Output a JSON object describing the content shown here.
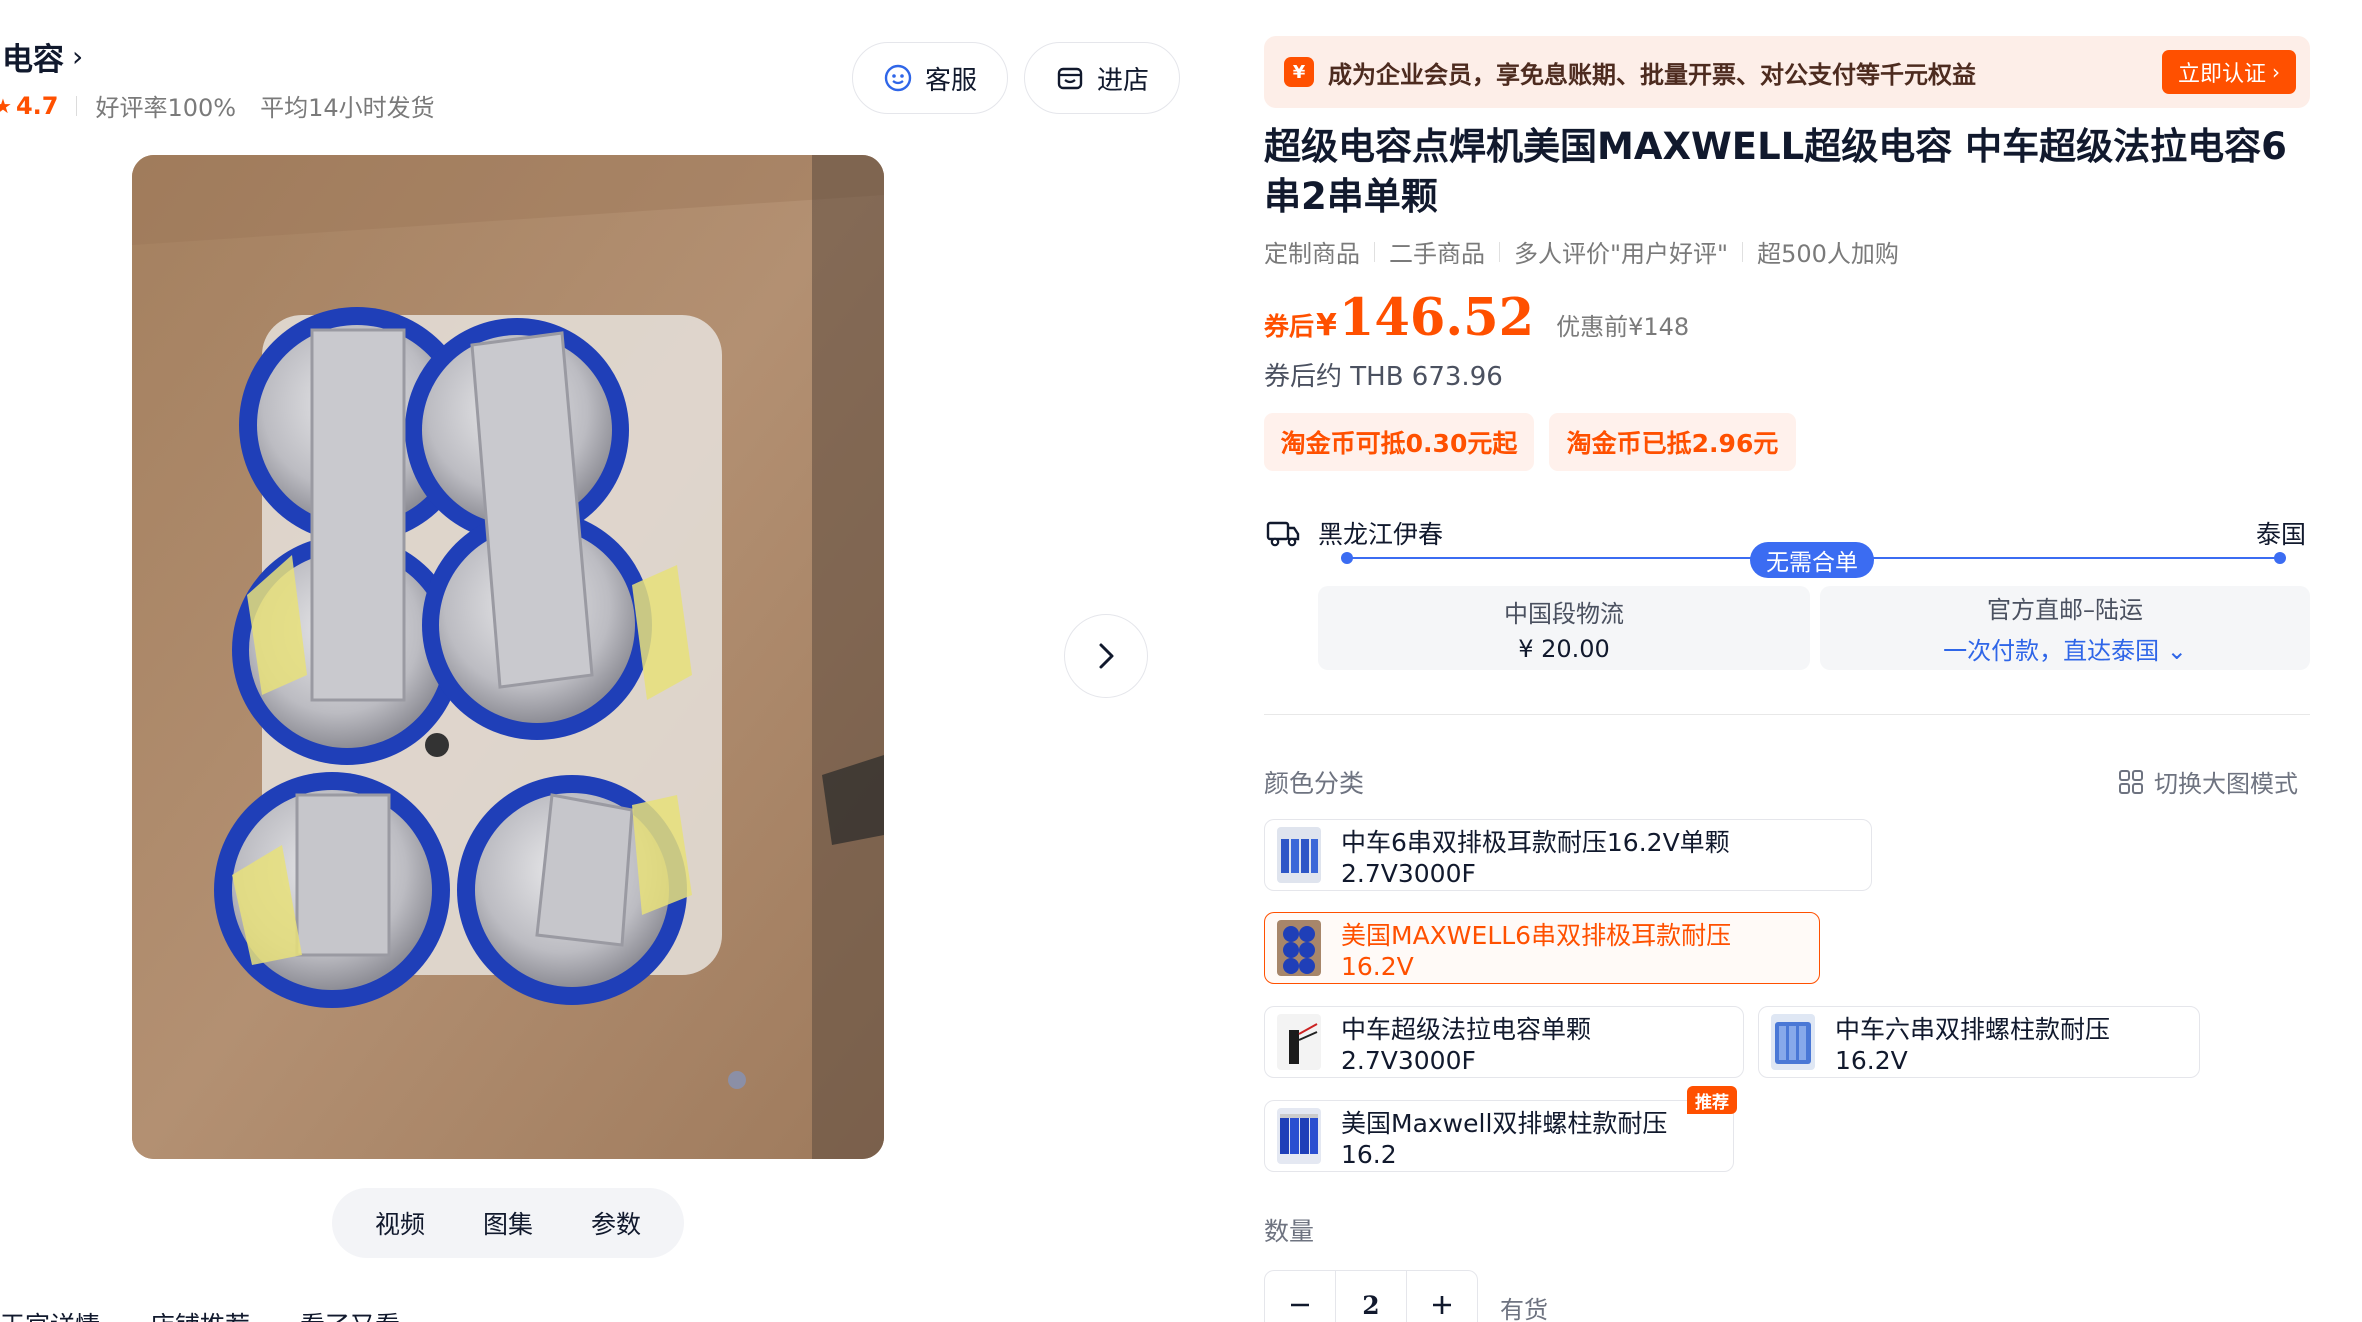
{
  "shop": {
    "name": "电容",
    "rating": "4.7",
    "good_rate": "好评率100%",
    "ship_time": "平均14小时发货"
  },
  "header_buttons": {
    "service": "客服",
    "store": "进店"
  },
  "gallery": {
    "tabs": [
      "视频",
      "图集",
      "参数"
    ]
  },
  "bottom_cut": "天官详情　　店铺推荐　　看了又看",
  "promo": {
    "text": "成为企业会员，享免息账期、批量开票、对公支付等千元权益",
    "button": "立即认证",
    "badge": "¥"
  },
  "product": {
    "title": "超级电容点焊机美国MAXWELL超级电容 中车超级法拉电容6串2串单颗",
    "tags": [
      "定制商品",
      "二手商品",
      "多人评价\"用户好评\"",
      "超500人加购"
    ],
    "price_prefix": "券后",
    "price_symbol": "¥",
    "price": "146.52",
    "original_price": "优惠前¥148",
    "thb": "券后约 THB 673.96",
    "coins": [
      "淘金币可抵0.30元起",
      "淘金币已抵2.96元"
    ]
  },
  "shipping": {
    "origin": "黑龙江伊春",
    "destination": "泰国",
    "badge": "无需合单",
    "segment_label": "中国段物流",
    "segment_price": "¥ 20.00",
    "direct_label": "官方直邮–陆运",
    "direct_note": "一次付款，直达泰国"
  },
  "options": {
    "label": "颜色分类",
    "switch_mode": "切换大图模式",
    "items": [
      {
        "label": "中车6串双排极耳款耐压16.2V单颗2.7V3000F",
        "selected": false
      },
      {
        "label": "美国MAXWELL6串双排极耳款耐压16.2V",
        "selected": true
      },
      {
        "label": "中车超级法拉电容单颗2.7V3000F",
        "selected": false
      },
      {
        "label": "中车六串双排螺柱款耐压16.2V",
        "selected": false
      },
      {
        "label": "美国Maxwell双排螺柱款耐压16.2",
        "selected": false
      }
    ],
    "recommend_badge": "推荐"
  },
  "quantity": {
    "label": "数量",
    "value": "2",
    "stock": "有货"
  },
  "colors": {
    "accent": "#ff5000",
    "blue": "#3b6cf2",
    "capacitor_blue": "#1f3fb8"
  }
}
